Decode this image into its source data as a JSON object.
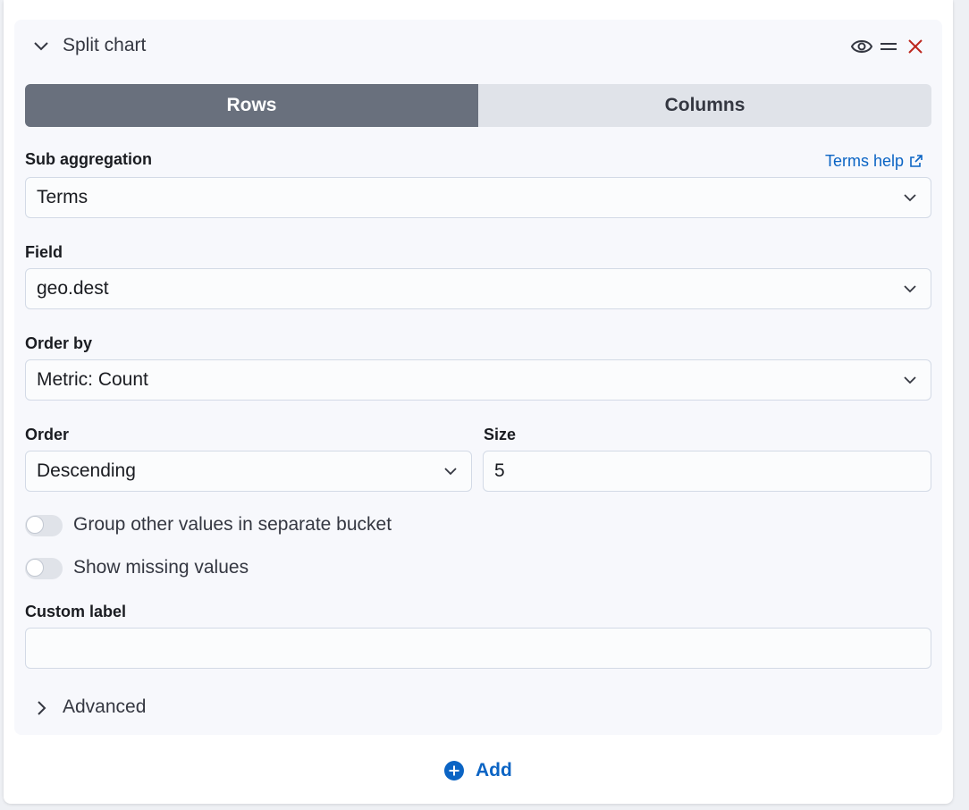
{
  "split": {
    "title": "Split chart",
    "seg_rows": "Rows",
    "seg_cols": "Columns",
    "sub_agg_label": "Sub aggregation",
    "terms_help": "Terms help",
    "sub_agg_value": "Terms",
    "field_label": "Field",
    "field_value": "geo.dest",
    "orderby_label": "Order by",
    "orderby_value": "Metric: Count",
    "order_label": "Order",
    "order_value": "Descending",
    "size_label": "Size",
    "size_value": "5",
    "group_other_label": "Group other values in separate bucket",
    "show_missing_label": "Show missing values",
    "custom_label_label": "Custom label",
    "custom_label_value": "",
    "advanced_label": "Advanced"
  },
  "footer": {
    "add_label": "Add"
  },
  "colors": {
    "accent": "#0b64c4",
    "danger": "#bd271e",
    "selected_segment": "#69707d"
  },
  "icons": {
    "collapse": "chevron-down-icon",
    "visibility": "eye-icon",
    "drag": "drag-handle-icon",
    "remove": "close-icon",
    "help_link": "external-link-icon",
    "advanced": "chevron-right-icon",
    "add": "plus-circle-icon"
  }
}
